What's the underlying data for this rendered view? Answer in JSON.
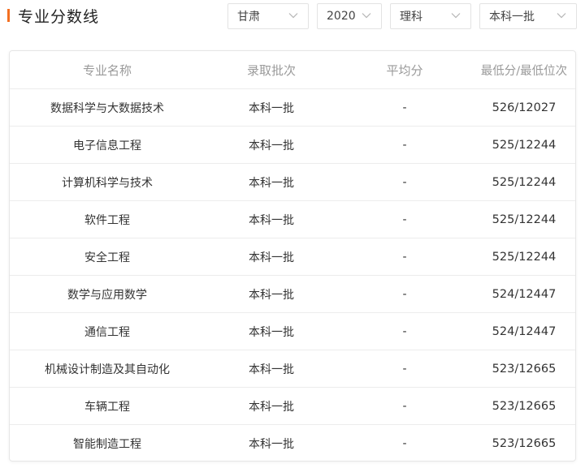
{
  "header": {
    "title": "专业分数线"
  },
  "filters": {
    "province": "甘肃",
    "year": "2020",
    "subject": "理科",
    "batch": "本科一批"
  },
  "table": {
    "columns": [
      "专业名称",
      "录取批次",
      "平均分",
      "最低分/最低位次"
    ],
    "rows": [
      [
        "数据科学与大数据技术",
        "本科一批",
        "-",
        "526/12027"
      ],
      [
        "电子信息工程",
        "本科一批",
        "-",
        "525/12244"
      ],
      [
        "计算机科学与技术",
        "本科一批",
        "-",
        "525/12244"
      ],
      [
        "软件工程",
        "本科一批",
        "-",
        "525/12244"
      ],
      [
        "安全工程",
        "本科一批",
        "-",
        "525/12244"
      ],
      [
        "数学与应用数学",
        "本科一批",
        "-",
        "524/12447"
      ],
      [
        "通信工程",
        "本科一批",
        "-",
        "524/12447"
      ],
      [
        "机械设计制造及其自动化",
        "本科一批",
        "-",
        "523/12665"
      ],
      [
        "车辆工程",
        "本科一批",
        "-",
        "523/12665"
      ],
      [
        "智能制造工程",
        "本科一批",
        "-",
        "523/12665"
      ]
    ]
  },
  "colors": {
    "accent": "#f36f21",
    "header_text": "#9a9a9a",
    "border": "#e6e6e6"
  },
  "icons": {
    "dropdown": "chevron-down-icon"
  }
}
